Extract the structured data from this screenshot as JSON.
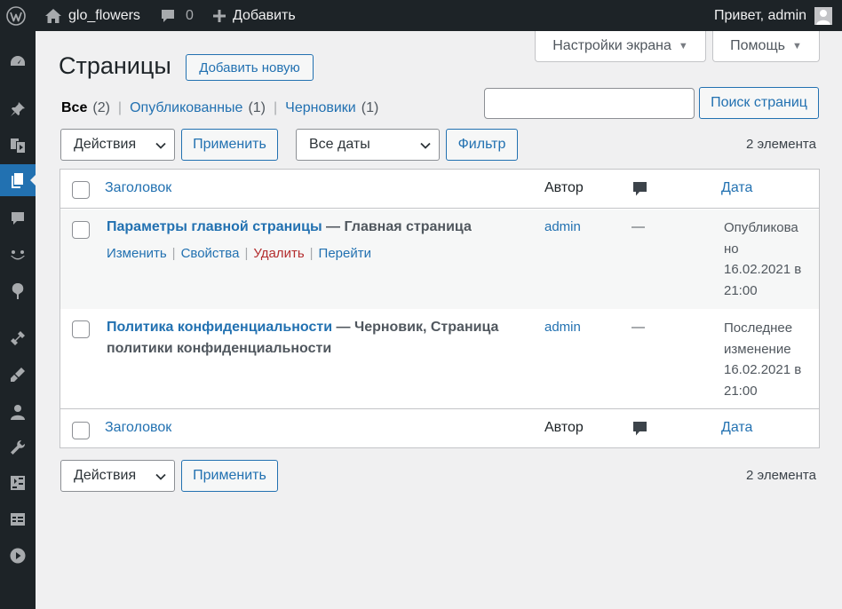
{
  "adminbar": {
    "site_name": "glo_flowers",
    "comments_count": "0",
    "new_label": "Добавить",
    "greeting": "Привет, admin"
  },
  "sidebar": {
    "items": [
      {
        "name": "dashboard-icon"
      },
      {
        "name": "posts-icon"
      },
      {
        "name": "media-icon"
      },
      {
        "name": "pages-icon",
        "current": true
      },
      {
        "name": "comments-icon"
      },
      {
        "name": "feedback-icon"
      },
      {
        "name": "appearance-icon"
      },
      {
        "name": "plugins-icon"
      },
      {
        "name": "woo-icon"
      },
      {
        "name": "users-icon"
      },
      {
        "name": "tools-icon"
      },
      {
        "name": "settings-icon"
      },
      {
        "name": "table-icon"
      },
      {
        "name": "collapse-icon"
      }
    ]
  },
  "screen_options": {
    "screen_label": "Настройки экрана",
    "help_label": "Помощь"
  },
  "page": {
    "title": "Страницы",
    "add_new_label": "Добавить новую"
  },
  "views": {
    "all_label": "Все",
    "all_count": "(2)",
    "published_label": "Опубликованные",
    "published_count": "(1)",
    "drafts_label": "Черновики",
    "drafts_count": "(1)",
    "sep": "|"
  },
  "search": {
    "placeholder": "",
    "button_label": "Поиск страниц"
  },
  "tablenav_top": {
    "bulk_actions": "Действия",
    "apply_label": "Применить",
    "dates_filter": "Все даты",
    "filter_label": "Фильтр",
    "items_count": "2 элемента"
  },
  "table": {
    "col_title": "Заголовок",
    "col_author": "Автор",
    "col_date": "Дата",
    "rows": [
      {
        "title": "Параметры главной страницы",
        "state": " — Главная страница",
        "actions": {
          "edit": "Изменить",
          "quick_edit": "Свойства",
          "trash": "Удалить",
          "view": "Перейти"
        },
        "author": "admin",
        "comments": "—",
        "date_status": "Опубликова но",
        "date_value": "16.02.2021 в 21:00"
      },
      {
        "title": "Политика конфиденциальности",
        "state": " — Черновик, Страница политики конфиденциальности",
        "author": "admin",
        "comments": "—",
        "date_status": "Последнее изменение",
        "date_value": "16.02.2021 в 21:00"
      }
    ]
  },
  "tablenav_bottom": {
    "bulk_actions": "Действия",
    "apply_label": "Применить",
    "items_count": "2 элемента"
  },
  "colors": {
    "accent": "#2271b1",
    "adminbar": "#1d2327",
    "background": "#f0f0f1",
    "trash": "#b32d2e"
  }
}
